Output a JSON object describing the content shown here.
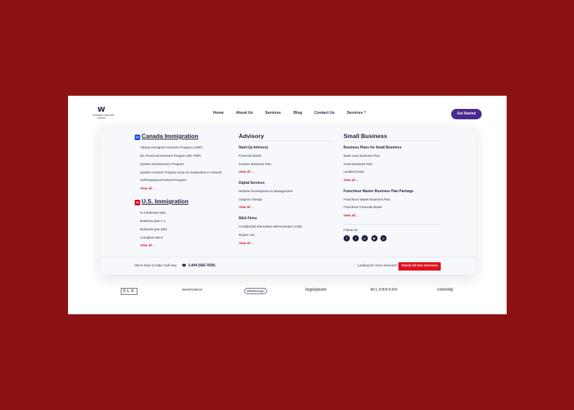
{
  "brand": {
    "mark": "W",
    "line1": "BUSINESS VENTURE",
    "line2": "CANADA"
  },
  "nav": {
    "items": [
      "Home",
      "About Us",
      "Services",
      "Blog",
      "Contact Us",
      "Services ^"
    ],
    "cta": "Get Started"
  },
  "mega": {
    "immigration": {
      "canada": {
        "flag": "CA",
        "title": "Canada Immigration",
        "links": [
          "Alberta Immigrant Nominee Program (AINP)",
          "BC Provincial Nominee Program (BC PNP)",
          "Quebec Entrepreneur Program",
          "Quebec Investor Program (may be suspended or revised)",
          "Self-Employed Persons Program"
        ],
        "view_all": "View all →"
      },
      "us": {
        "flag": "US",
        "title": "U.S. Immigration",
        "links": [
          "E-2 Business plan",
          "Business plan L-1",
          "Business plan EB2",
          "Compliant EB-5"
        ],
        "view_all": "View all →"
      }
    },
    "advisory": {
      "title": "Advisory",
      "groups": [
        {
          "title": "Start-Up Advisory",
          "links": [
            "Financial Model",
            "Investor Business Plan"
          ],
          "view_all": "View all →"
        },
        {
          "title": "Digital Services",
          "links": [
            "Website Development & Management",
            "Graphics Design"
          ],
          "view_all": "View all →"
        },
        {
          "title": "M&A Firms",
          "links": [
            "Confidential Information Memorandum (CIM)",
            "Buyers List"
          ],
          "view_all": "View all →"
        }
      ]
    },
    "small_business": {
      "title": "Small Business",
      "groups": [
        {
          "title": "Business Plans for Small Business",
          "links": [
            "Bank Loan Business Plan",
            "Grant Business Plan",
            "Landlord Deck"
          ],
          "view_all": "View all →"
        },
        {
          "title": "Franchisor Master Business Plan Package",
          "links": [
            "Franchisor Master Business Plan",
            "Franchisor Financial Model"
          ],
          "view_all": "View all →"
        }
      ],
      "follow_us": "Follow Us",
      "social": [
        "f",
        "t",
        "p",
        "▶",
        "p"
      ]
    },
    "footer": {
      "help": "We're here to help! Call now:",
      "phone_icon": "☎",
      "phone": "1-844 (566-7639)",
      "looking": "Looking for more services?",
      "button": "Check All Our Services"
    }
  },
  "partner_logos": [
    "SLS",
    "SIGHTCHECK",
    "MilieDesign",
    "logoipsum",
    "MILOBRAND",
    "comody"
  ]
}
